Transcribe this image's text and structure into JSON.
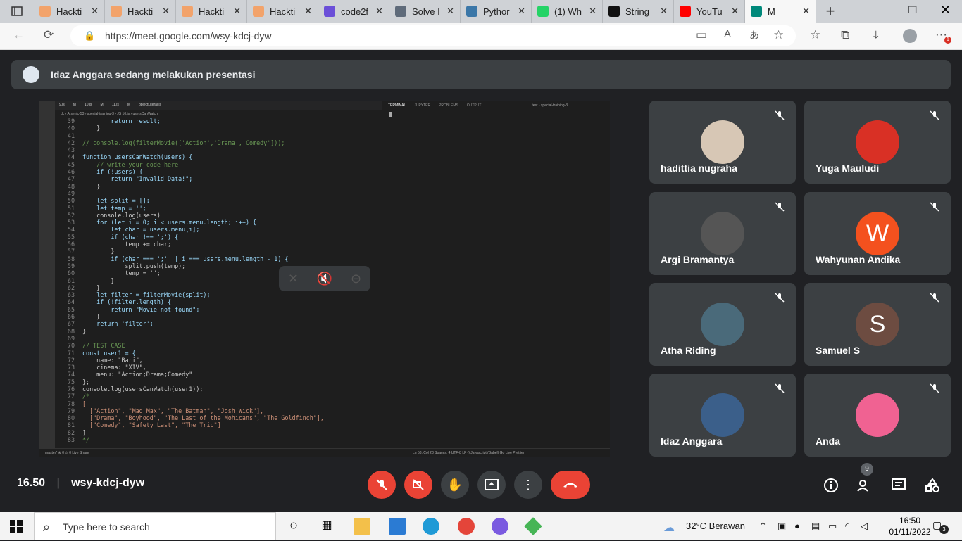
{
  "browser": {
    "tabs": [
      {
        "label": "Hackti",
        "icon": "hacktiv8-icon",
        "color": "#f2a36b"
      },
      {
        "label": "Hackti",
        "icon": "hacktiv8-icon",
        "color": "#f2a36b"
      },
      {
        "label": "Hackti",
        "icon": "hacktiv8-icon",
        "color": "#f2a36b"
      },
      {
        "label": "Hackti",
        "icon": "hacktiv8-icon",
        "color": "#f2a36b"
      },
      {
        "label": "code2f",
        "icon": "code2flow-icon",
        "color": "#6b4fd8"
      },
      {
        "label": "Solve I",
        "icon": "solve-icon",
        "color": "#5f6b7a"
      },
      {
        "label": "Pythor",
        "icon": "python-icon",
        "color": "#3b77a8"
      },
      {
        "label": "(1) Wh",
        "icon": "whatsapp-icon",
        "color": "#25d366"
      },
      {
        "label": "String",
        "icon": "medium-icon",
        "color": "#111111"
      },
      {
        "label": "YouTu",
        "icon": "youtube-icon",
        "color": "#ff0000"
      },
      {
        "label": "M",
        "icon": "meet-icon",
        "color": "#00897b"
      }
    ],
    "url": "https://meet.google.com/wsy-kdcj-dyw",
    "download_badge_color": "#f2a100"
  },
  "meet": {
    "presenter_banner": "Idaz Anggara sedang melakukan presentasi",
    "time": "16.50",
    "meeting_code": "wsy-kdcj-dyw",
    "participants_count": "9",
    "participants": [
      {
        "name": "hadittia nugraha",
        "avatar_color": "#d7c7b5",
        "initial": ""
      },
      {
        "name": "Yuga Mauludi",
        "avatar_color": "#d93025",
        "initial": ""
      },
      {
        "name": "Argi Bramantya",
        "avatar_color": "#555555",
        "initial": ""
      },
      {
        "name": "Wahyunan Andika",
        "avatar_color": "#f4511e",
        "initial": "W"
      },
      {
        "name": "Atha Riding",
        "avatar_color": "#4a6a7a",
        "initial": ""
      },
      {
        "name": "Samuel S",
        "avatar_color": "#6d4c41",
        "initial": "S"
      },
      {
        "name": "Idaz Anggara",
        "avatar_color": "#3b5f8a",
        "initial": ""
      },
      {
        "name": "Anda",
        "avatar_color": "#f06292",
        "initial": ""
      }
    ]
  },
  "editor": {
    "tabs": [
      "9.js",
      "M",
      "10.js",
      "M",
      "11.js",
      "M",
      "objectLiteral.js"
    ],
    "breadcrumb": "dc › Arsenic-53 › special-training-3 › JS 10.js › usersCanWatch",
    "lines": [
      {
        "n": "39",
        "t": "        return result;"
      },
      {
        "n": "40",
        "t": "    }"
      },
      {
        "n": "41",
        "t": ""
      },
      {
        "n": "42",
        "t": "// console.log(filterMovie(['Action','Drama','Comedy']));"
      },
      {
        "n": "43",
        "t": ""
      },
      {
        "n": "44",
        "t": "function usersCanWatch(users) {"
      },
      {
        "n": "45",
        "t": "    // write your code here"
      },
      {
        "n": "46",
        "t": "    if (!users) {"
      },
      {
        "n": "47",
        "t": "        return \"Invalid Data!\";"
      },
      {
        "n": "48",
        "t": "    }"
      },
      {
        "n": "49",
        "t": ""
      },
      {
        "n": "50",
        "t": "    let split = [];"
      },
      {
        "n": "51",
        "t": "    let temp = '';"
      },
      {
        "n": "52",
        "t": "    console.log(users)"
      },
      {
        "n": "53",
        "t": "    for (let i = 0; i < users.menu.length; i++) {"
      },
      {
        "n": "54",
        "t": "        let char = users.menu[i];"
      },
      {
        "n": "55",
        "t": "        if (char !== ';') {"
      },
      {
        "n": "56",
        "t": "            temp += char;"
      },
      {
        "n": "57",
        "t": "        }"
      },
      {
        "n": "58",
        "t": "        if (char === ';' || i === users.menu.length - 1) {"
      },
      {
        "n": "59",
        "t": "            split.push(temp);"
      },
      {
        "n": "60",
        "t": "            temp = '';"
      },
      {
        "n": "61",
        "t": "        }"
      },
      {
        "n": "62",
        "t": "    }"
      },
      {
        "n": "63",
        "t": "    let filter = filterMovie(split);"
      },
      {
        "n": "64",
        "t": "    if (!filter.length) {"
      },
      {
        "n": "65",
        "t": "        return \"Movie not found\";"
      },
      {
        "n": "66",
        "t": "    }"
      },
      {
        "n": "67",
        "t": "    return 'filter';"
      },
      {
        "n": "68",
        "t": "}"
      },
      {
        "n": "69",
        "t": ""
      },
      {
        "n": "70",
        "t": "// TEST CASE"
      },
      {
        "n": "71",
        "t": "const user1 = {"
      },
      {
        "n": "72",
        "t": "    name: \"Bari\","
      },
      {
        "n": "73",
        "t": "    cinema: \"XIV\","
      },
      {
        "n": "74",
        "t": "    menu: \"Action;Drama;Comedy\""
      },
      {
        "n": "75",
        "t": "};"
      },
      {
        "n": "76",
        "t": "console.log(usersCanWatch(user1));"
      },
      {
        "n": "77",
        "t": "/*"
      },
      {
        "n": "78",
        "t": "["
      },
      {
        "n": "79",
        "t": "  [\"Action\", \"Mad Max\", \"The Batman\", \"Josh Wick\"],"
      },
      {
        "n": "80",
        "t": "  [\"Drama\", \"Boyhood\", \"The Last of the Mohicans\", \"The Goldfinch\"],"
      },
      {
        "n": "81",
        "t": "  [\"Comedy\", \"Safety Last\", \"The Trip\"]"
      },
      {
        "n": "82",
        "t": "]"
      },
      {
        "n": "83",
        "t": "*/"
      }
    ],
    "terminal_tabs": [
      "TERMINAL",
      "JUPYTER",
      "PROBLEMS",
      "OUTPUT"
    ],
    "terminal_title": "test - special-training-3",
    "status_left": "master*   ⊗ 0 ⚠ 0   Live Share",
    "status_right": "Ln 53, Col 28   Spaces: 4   UTF-8   LF   {} Javascript (Babel)   Go Live   Prettier"
  },
  "taskbar": {
    "search_placeholder": "Type here to search",
    "weather": "32°C  Berawan",
    "time": "16:50",
    "date": "01/11/2022",
    "notifications": "3"
  }
}
